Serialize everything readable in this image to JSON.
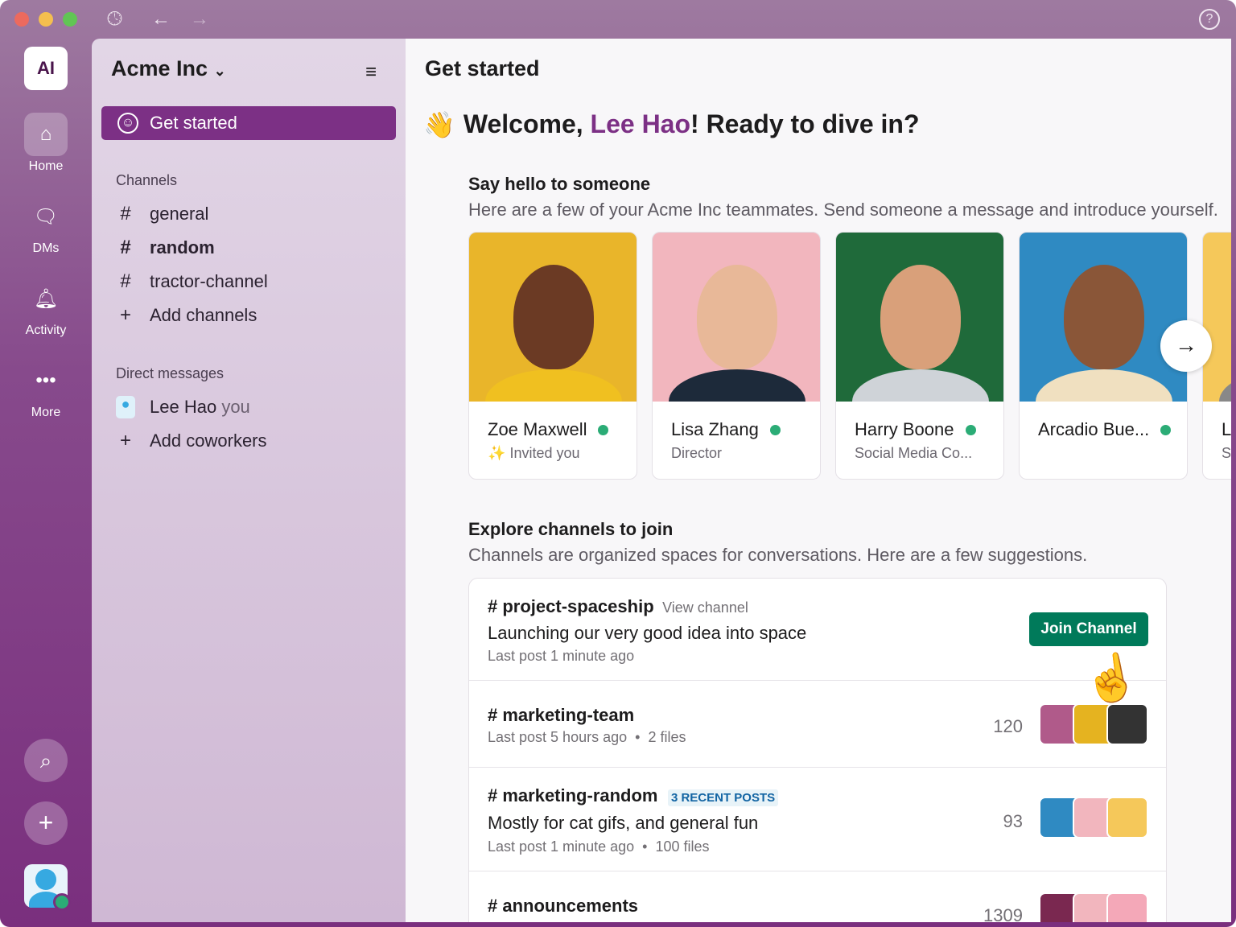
{
  "window": {
    "controls": [
      "close",
      "minimize",
      "zoom"
    ],
    "help_icon": "help-circle-icon"
  },
  "rail": {
    "workspace_initials": "AI",
    "items": [
      {
        "label": "Home",
        "icon": "home-icon"
      },
      {
        "label": "DMs",
        "icon": "dms-icon"
      },
      {
        "label": "Activity",
        "icon": "bell-icon"
      },
      {
        "label": "More",
        "icon": "more-icon"
      }
    ]
  },
  "sidebar": {
    "workspace": "Acme Inc",
    "active_item": "Get started",
    "channels_header": "Channels",
    "channels": [
      "general",
      "random",
      "tractor-channel"
    ],
    "add_channels": "Add channels",
    "dm_header": "Direct messages",
    "dm_name": "Lee Hao",
    "dm_you": "you",
    "add_coworkers": "Add coworkers"
  },
  "main": {
    "title": "Get started",
    "welcome_prefix": "Welcome, ",
    "welcome_name": "Lee Hao",
    "welcome_suffix": "! Ready to dive in?",
    "accent": "#7c3085",
    "hello": {
      "heading": "Say hello to someone",
      "desc": "Here are a few of your Acme Inc teammates. Send someone a message and introduce yourself.",
      "people": [
        {
          "name": "Zoe Maxwell",
          "sub": "Invited you",
          "sparkle": "✨",
          "bg": "#e9b52a"
        },
        {
          "name": "Lisa Zhang",
          "sub": "Director",
          "bg": "#f2b6be"
        },
        {
          "name": "Harry Boone",
          "sub": "Social Media Co...",
          "bg": "#1f6a3a"
        },
        {
          "name": "Arcadio Bue...",
          "sub": "",
          "bg": "#2f8ac2"
        },
        {
          "name": "L",
          "sub": "S",
          "bg": "#f5c85a"
        }
      ]
    },
    "explore": {
      "heading": "Explore channels to join",
      "desc": "Channels are organized spaces for conversations. Here are a few suggestions.",
      "channels": [
        {
          "name": "# project-spaceship",
          "link": "View channel",
          "desc": "Launching our very good idea into space",
          "meta": "Last post 1 minute ago",
          "button": "Join Channel"
        },
        {
          "name": "# marketing-team",
          "meta": "Last post 5 hours ago",
          "files": "2 files",
          "count": "120"
        },
        {
          "name": "# marketing-random",
          "badge": "3 RECENT POSTS",
          "desc": "Mostly for cat gifs, and general fun",
          "meta": "Last post 1 minute ago",
          "files": "100 files",
          "count": "93"
        },
        {
          "name": "# announcements",
          "count": "1309"
        }
      ]
    }
  }
}
